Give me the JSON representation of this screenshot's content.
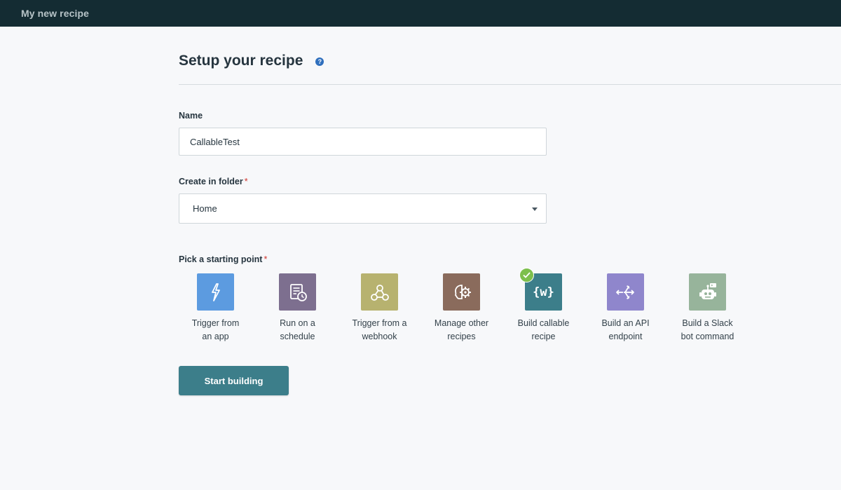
{
  "topbar": {
    "title": "My new recipe"
  },
  "page": {
    "heading": "Setup your recipe",
    "help_glyph": "?"
  },
  "name_field": {
    "label": "Name",
    "value": "CallableTest"
  },
  "folder_field": {
    "label": "Create in folder",
    "required_mark": "*",
    "value": "Home"
  },
  "starting_point": {
    "label": "Pick a starting point",
    "required_mark": "*",
    "selected": "Build callable recipe",
    "items": [
      {
        "line1": "Trigger from",
        "line2": "an app",
        "icon": "bolt-icon",
        "color": "#5c9be0"
      },
      {
        "line1": "Run on a",
        "line2": "schedule",
        "icon": "schedule-icon",
        "color": "#7d6f8f"
      },
      {
        "line1": "Trigger from a",
        "line2": "webhook",
        "icon": "webhook-icon",
        "color": "#b7b26f"
      },
      {
        "line1": "Manage other",
        "line2": "recipes",
        "icon": "brain-gear-icon",
        "color": "#8a6b5c"
      },
      {
        "line1": "Build callable",
        "line2": "recipe",
        "icon": "callable-w-icon",
        "color": "#3c7e8a",
        "glyph": "{w}"
      },
      {
        "line1": "Build an API",
        "line2": "endpoint",
        "icon": "api-endpoint-icon",
        "color": "#8f86cc"
      },
      {
        "line1": "Build a Slack",
        "line2": "bot command",
        "icon": "slack-bot-icon",
        "color": "#97b49b"
      }
    ]
  },
  "actions": {
    "start_label": "Start building"
  }
}
